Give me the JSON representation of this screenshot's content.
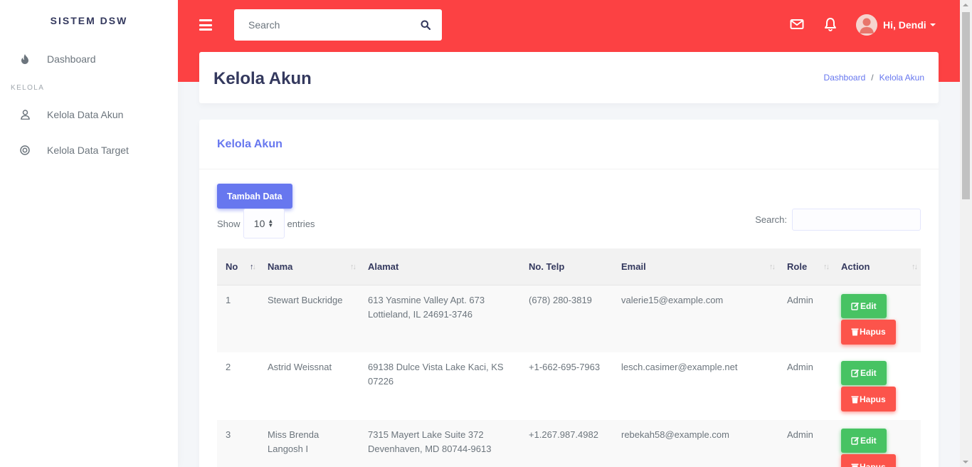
{
  "sidebar": {
    "brand": "SISTEM DSW",
    "dashboard": "Dashboard",
    "section_header": "KELOLA",
    "items": [
      {
        "label": "Kelola Data Akun",
        "icon": "user-icon"
      },
      {
        "label": "Kelola Data Target",
        "icon": "target-icon"
      }
    ]
  },
  "topbar": {
    "search_placeholder": "Search",
    "user_name": "Hi, Dendi",
    "accent": "#fc4143"
  },
  "header": {
    "title": "Kelola Akun",
    "breadcrumb": [
      "Dashboard",
      "Kelola Akun"
    ]
  },
  "card": {
    "title": "Kelola Akun",
    "add_button": "Tambah Data",
    "show_label": "Show",
    "entries_value": "10",
    "entries_label": "entries",
    "search_label": "Search:"
  },
  "table": {
    "columns": [
      "No",
      "Nama",
      "Alamat",
      "No. Telp",
      "Email",
      "Role",
      "Action"
    ],
    "edit_label": "Edit",
    "delete_label": "Hapus",
    "rows": [
      {
        "no": "1",
        "nama": "Stewart Buckridge",
        "alamat": "613 Yasmine Valley Apt. 673 Lottieland, IL 24691-3746",
        "telp": "(678) 280-3819",
        "email": "valerie15@example.com",
        "role": "Admin"
      },
      {
        "no": "2",
        "nama": "Astrid Weissnat",
        "alamat": "69138 Dulce Vista Lake Kaci, KS 07226",
        "telp": "+1-662-695-7963",
        "email": "lesch.casimer@example.net",
        "role": "Admin"
      },
      {
        "no": "3",
        "nama": "Miss Brenda Langosh I",
        "alamat": "7315 Mayert Lake Suite 372 Devenhaven, MD 80744-9613",
        "telp": "+1.267.987.4982",
        "email": "rebekah58@example.com",
        "role": "Admin"
      }
    ]
  }
}
